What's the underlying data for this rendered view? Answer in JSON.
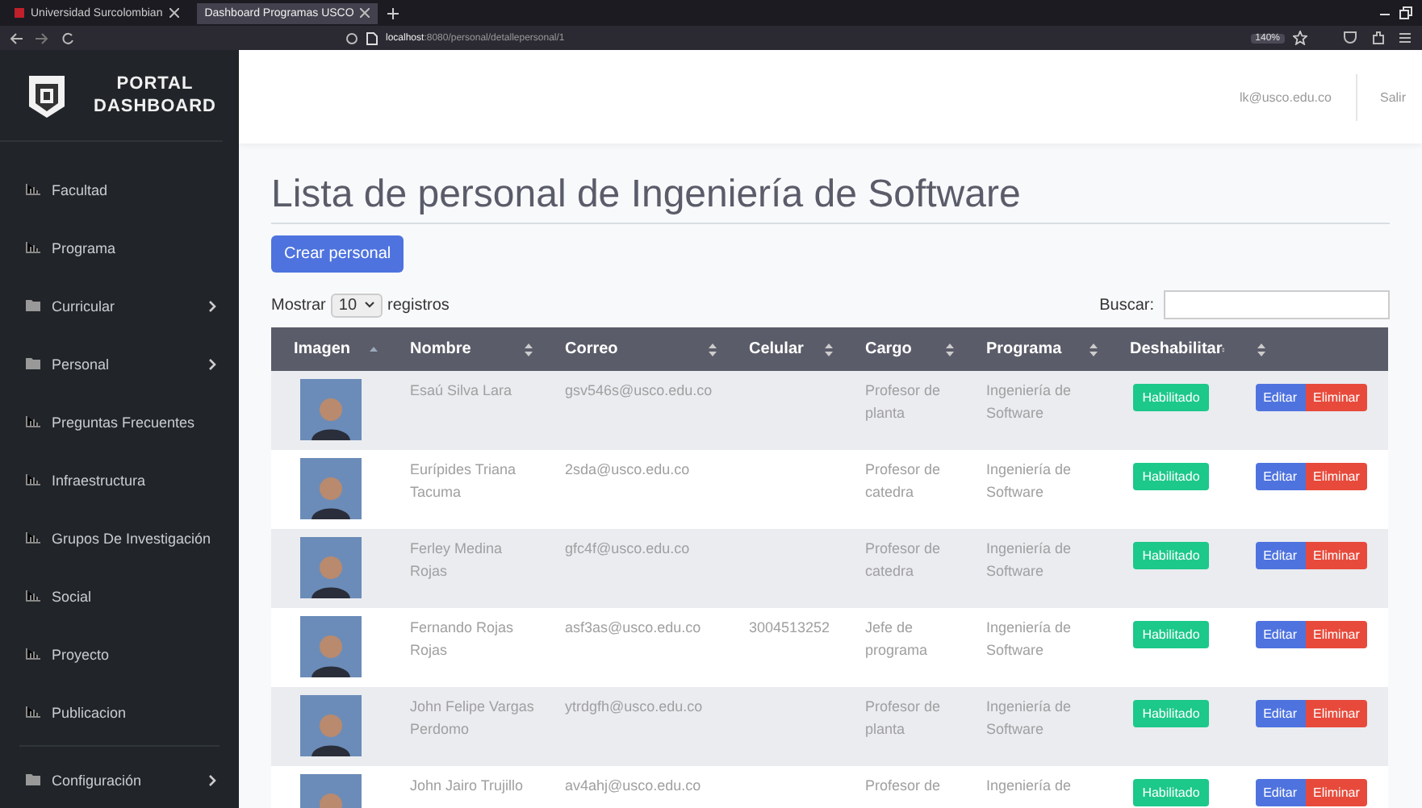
{
  "browser": {
    "tabs": [
      {
        "title": "Universidad Surcolombian",
        "selected": false
      },
      {
        "title": "Dashboard Programas USCO",
        "selected": true
      }
    ],
    "url_host": "localhost",
    "url_path": ":8080/personal/detallepersonal/1",
    "zoom": "140%"
  },
  "sidebar": {
    "brand_line1": "PORTAL",
    "brand_line2": "DASHBOARD",
    "items": [
      {
        "label": "Facultad",
        "kind": "page"
      },
      {
        "label": "Programa",
        "kind": "page"
      },
      {
        "label": "Curricular",
        "kind": "group"
      },
      {
        "label": "Personal",
        "kind": "group"
      },
      {
        "label": "Preguntas Frecuentes",
        "kind": "page"
      },
      {
        "label": "Infraestructura",
        "kind": "page"
      },
      {
        "label": "Grupos De Investigación",
        "kind": "page"
      },
      {
        "label": "Social",
        "kind": "page"
      },
      {
        "label": "Proyecto",
        "kind": "page"
      },
      {
        "label": "Publicacion",
        "kind": "page"
      }
    ],
    "bottom_items": [
      {
        "label": "Configuración",
        "kind": "group"
      }
    ]
  },
  "header": {
    "user": "lk@usco.edu.co",
    "logout": "Salir"
  },
  "page": {
    "title": "Lista de personal de Ingeniería de Software",
    "create_button": "Crear personal",
    "show_label": "Mostrar",
    "page_size": "10",
    "records_label": "registros",
    "search_label": "Buscar:"
  },
  "table": {
    "columns": [
      {
        "label": "Imagen",
        "sorted": true
      },
      {
        "label": "Nombre",
        "sorted": false
      },
      {
        "label": "Correo",
        "sorted": false
      },
      {
        "label": "Celular",
        "sorted": false
      },
      {
        "label": "Cargo",
        "sorted": false
      },
      {
        "label": "Programa",
        "sorted": false
      },
      {
        "label": "Deshabilitar",
        "sorted": false
      },
      {
        "sorted": false
      }
    ],
    "rows": [
      {
        "name": "Esaú Silva Lara",
        "email": "gsv546s@usco.edu.co",
        "cargo": "Profesor de planta",
        "programa": "Ingeniería de Software",
        "status": "Habilitado",
        "enabled": true,
        "edit": "Editar",
        "delete": "Eliminar"
      },
      {
        "name": "Eurípides Triana Tacuma",
        "email": "2sda@usco.edu.co",
        "cargo": "Profesor de catedra",
        "programa": "Ingeniería de Software",
        "status": "Habilitado",
        "enabled": true,
        "edit": "Editar",
        "delete": "Eliminar"
      },
      {
        "name": "Ferley Medina Rojas",
        "email": "gfc4f@usco.edu.co",
        "cargo": "Profesor de catedra",
        "programa": "Ingeniería de Software",
        "status": "Habilitado",
        "enabled": true,
        "edit": "Editar",
        "delete": "Eliminar"
      },
      {
        "name": "Fernando Rojas Rojas",
        "email": "asf3as@usco.edu.co",
        "phone": "3004513252",
        "cargo": "Jefe de programa",
        "programa": "Ingeniería de Software",
        "status": "Habilitado",
        "enabled": true,
        "edit": "Editar",
        "delete": "Eliminar"
      },
      {
        "name": "John Felipe Vargas Perdomo",
        "email": "ytrdgfh@usco.edu.co",
        "cargo": "Profesor de planta",
        "programa": "Ingeniería de Software",
        "status": "Habilitado",
        "enabled": true,
        "edit": "Editar",
        "delete": "Eliminar"
      },
      {
        "name": "John Jairo Trujillo",
        "email": "av4ahj@usco.edu.co",
        "cargo": "Profesor de",
        "programa": "Ingeniería de",
        "status": "Habilitado",
        "enabled": true,
        "edit": "Editar",
        "delete": "Eliminar"
      }
    ]
  }
}
